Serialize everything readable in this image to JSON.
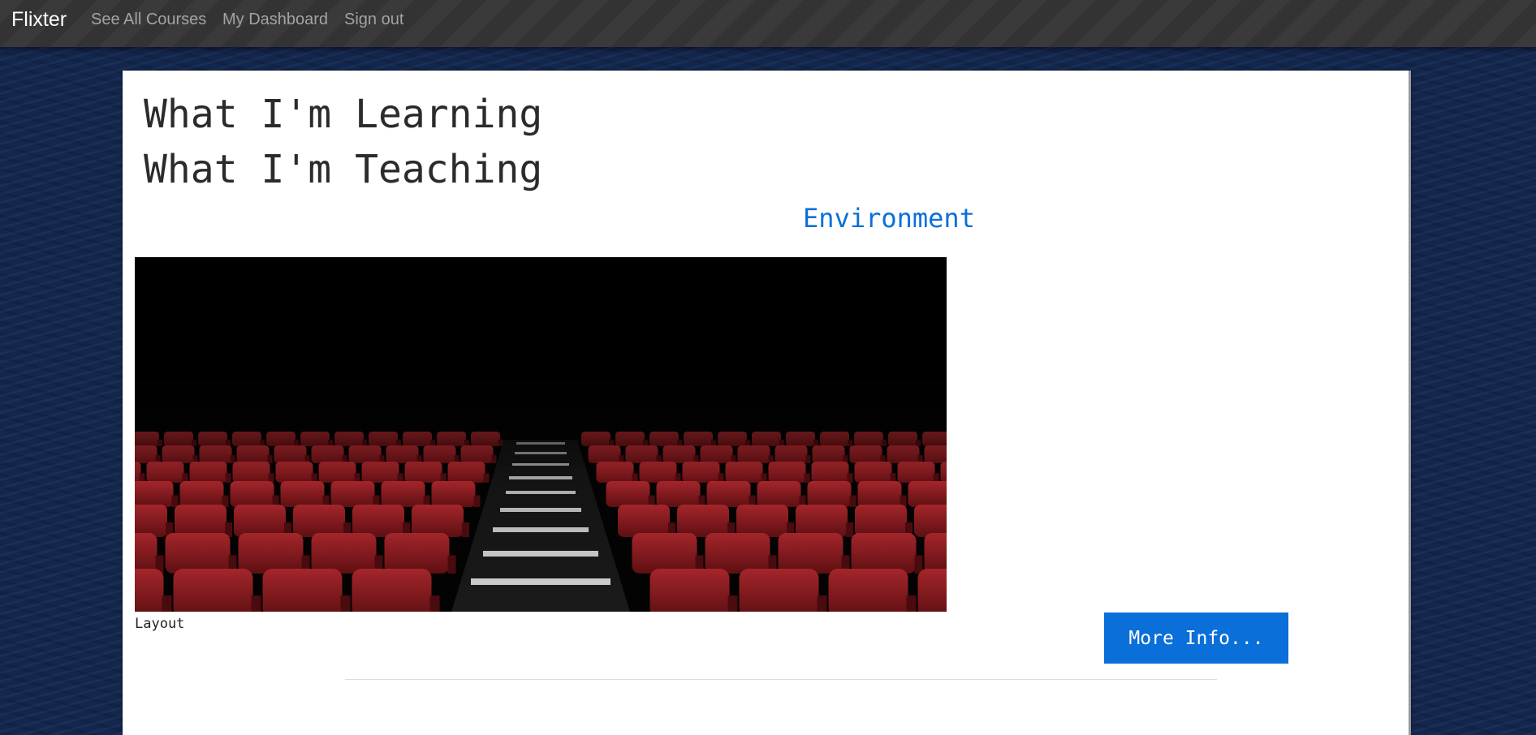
{
  "navbar": {
    "brand": "Flixter",
    "links": [
      {
        "label": "See All Courses"
      },
      {
        "label": "My Dashboard"
      },
      {
        "label": "Sign out"
      }
    ]
  },
  "main": {
    "headings": [
      "What I'm Learning",
      "What I'm Teaching"
    ],
    "course": {
      "title": "Environment",
      "image_description": "theater-seats-image",
      "caption": "Layout",
      "more_button_label": "More Info..."
    }
  },
  "colors": {
    "navbar_bg": "#333333",
    "page_bg": "#13264d",
    "accent": "#0a6fd8",
    "seat_red": "#8e1a1d"
  }
}
